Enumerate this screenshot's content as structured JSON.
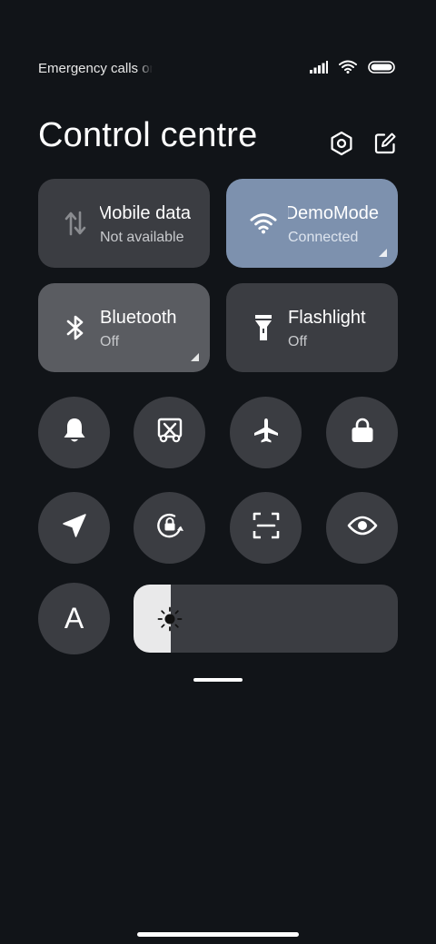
{
  "status_bar": {
    "carrier_text": "Emergency calls only",
    "signal_icon": "cellular-signal-icon",
    "wifi_icon": "wifi-icon",
    "battery_icon": "battery-icon"
  },
  "header": {
    "title": "Control centre",
    "settings_icon": "settings-hexagon-icon",
    "edit_icon": "edit-icon"
  },
  "tiles": [
    {
      "label": "Mobile data",
      "sublabel": "Not available",
      "icon": "mobile-data-icon",
      "state": "off"
    },
    {
      "label": "DemoMode",
      "sublabel": "Connected",
      "icon": "wifi-icon",
      "state": "on"
    },
    {
      "label": "Bluetooth",
      "sublabel": "Off",
      "icon": "bluetooth-icon",
      "state": "off"
    },
    {
      "label": "Flashlight",
      "sublabel": "Off",
      "icon": "flashlight-icon",
      "state": "off"
    }
  ],
  "toggles_row1": [
    "bell-icon",
    "screenshot-icon",
    "airplane-icon",
    "lock-icon"
  ],
  "toggles_row2": [
    "location-icon",
    "rotation-lock-icon",
    "scan-icon",
    "eye-icon"
  ],
  "auto_brightness": {
    "label": "A",
    "icon": "auto-brightness-icon"
  },
  "brightness": {
    "level": 0.14,
    "icon": "sun-icon"
  },
  "colors": {
    "background": "#111418",
    "tile": "#3b3d42",
    "tile_active": "#7d91ae",
    "tile_dimmed": "#5a5c61",
    "brightness_fill": "#e9e9ea"
  }
}
